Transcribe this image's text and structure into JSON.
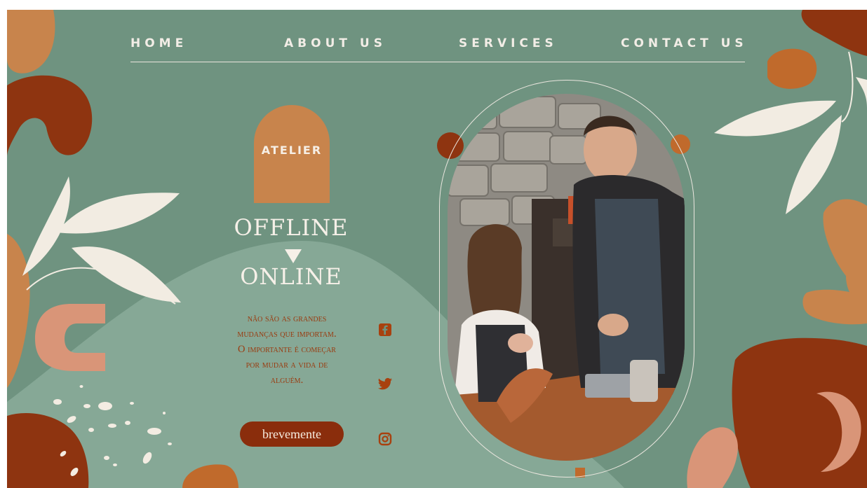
{
  "nav": {
    "items": [
      {
        "label": "HOME"
      },
      {
        "label": "ABOUT US"
      },
      {
        "label": "SERVICES"
      },
      {
        "label": "CONTACT US"
      }
    ]
  },
  "hero": {
    "badge": "ATELIER",
    "headline_top": "OFFLINE",
    "headline_bottom": "ONLINE",
    "quote_lines": [
      "não são as grandes",
      "mudanças que importam.",
      "O importante é começar",
      "por mudar a vida de",
      "alguém."
    ],
    "cta_label": "brevemente"
  },
  "social": [
    {
      "name": "facebook-icon",
      "glyph": "f"
    },
    {
      "name": "twitter-icon",
      "glyph": "🐦"
    },
    {
      "name": "instagram-icon",
      "glyph": "◎"
    }
  ],
  "colors": {
    "background": "#6f9380",
    "rust": "#8a2d0c",
    "terracotta": "#c8844c",
    "blush": "#dc9b7a",
    "cream": "#f6f0e8"
  }
}
